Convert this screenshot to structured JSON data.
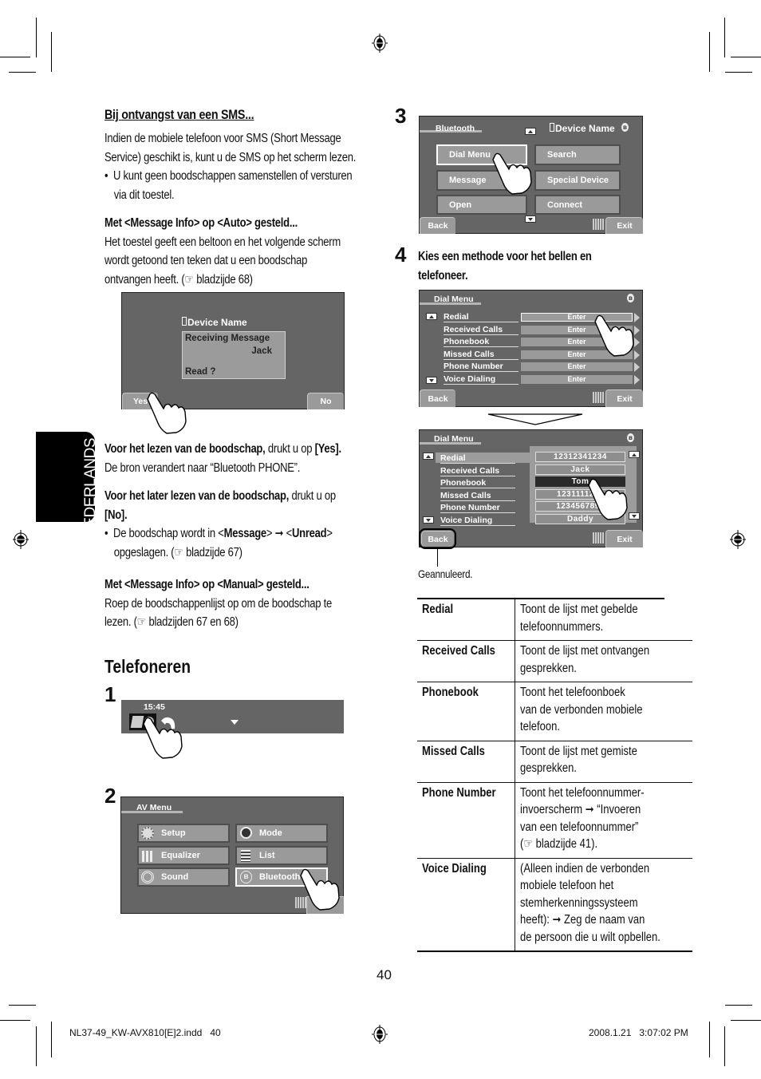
{
  "left": {
    "sms_heading": "Bij ontvangst van een SMS...",
    "sms_intro_1": "Indien de mobiele telefoon voor SMS (Short Message",
    "sms_intro_2": "Service) geschikt is, kunt u de SMS op het scherm lezen.",
    "sms_bullet_1": "U kunt geen boodschappen samenstellen of versturen",
    "sms_bullet_2": "via dit toestel.",
    "auto_heading": "Met <Message Info> op <Auto> gesteld...",
    "auto_text_1": "Het toestel geeft een beltoon en het volgende scherm",
    "auto_text_2": "wordt getoond ten teken dat u een boodschap",
    "auto_text_3": "ontvangen heeft. (☞ bladzijde 68)",
    "sms_screen": {
      "device_name": "Device Name",
      "line1": "Receiving Message",
      "line2": "Jack",
      "line3": "Read ?",
      "yes_label": "Yes",
      "no_label": "No"
    },
    "read_now_bold": "Voor het lezen van de boodschap,",
    "read_now_rest": " drukt u op ",
    "read_now_key": "[Yes].",
    "read_now_text": "De bron verandert naar “Bluetooth PHONE”.",
    "read_later_bold": "Voor het later lezen van de boodschap,",
    "read_later_rest": " drukt u op",
    "read_later_key": "[No].",
    "read_later_bullet_a": "De boodschap wordt in <",
    "read_later_bullet_b": "Message",
    "read_later_bullet_c": "> ➞ <",
    "read_later_bullet_d": "Unread",
    "read_later_bullet_e": ">",
    "read_later_bullet_2": "opgeslagen. (☞ bladzijde 67)",
    "manual_heading": "Met <Message Info> op <Manual> gesteld...",
    "manual_text_1": "Roep de boodschappenlijst op om de boodschap te",
    "manual_text_2": "lezen. (☞ bladzijden 67 en 68)",
    "section_title": "Telefoneren",
    "step1": "1",
    "step1_screen": {
      "time": "15:45"
    },
    "step2": "2",
    "av_menu": {
      "title": "AV Menu",
      "items": [
        {
          "label": "Setup",
          "icon": "gear-icon"
        },
        {
          "label": "Mode",
          "icon": "mode-icon"
        },
        {
          "label": "Equalizer",
          "icon": "equalizer-icon"
        },
        {
          "label": "List",
          "icon": "list-icon"
        },
        {
          "label": "Sound",
          "icon": "sound-icon"
        },
        {
          "label": "Bluetooth",
          "icon": "bluetooth-icon"
        }
      ]
    }
  },
  "side_tab": "NEDERLANDS",
  "right": {
    "step3": "3",
    "bt_screen": {
      "title": "Bluetooth",
      "device_name": "Device Name",
      "buttons": [
        "Dial Menu",
        "Search",
        "Message",
        "Special Device",
        "Open",
        "Connect"
      ],
      "back_label": "Back",
      "exit_label": "Exit"
    },
    "step4": "4",
    "step4_text_1": "Kies een methode voor het bellen en",
    "step4_text_2": "telefoneer.",
    "dial_screen": {
      "title": "Dial Menu",
      "items": [
        "Redial",
        "Received Calls",
        "Phonebook",
        "Missed Calls",
        "Phone Number",
        "Voice Dialing"
      ],
      "enter_label": "Enter",
      "back_label": "Back",
      "exit_label": "Exit"
    },
    "dial_screen_2": {
      "title": "Dial Menu",
      "items": [
        "Redial",
        "Received Calls",
        "Phonebook",
        "Missed Calls",
        "Phone Number",
        "Voice Dialing"
      ],
      "numbers": [
        "12312341234",
        "Jack",
        "Tom",
        "1231111222",
        "1234567890",
        "Daddy"
      ],
      "selected_number": "Tom",
      "back_label": "Back",
      "exit_label": "Exit"
    },
    "cancel_caption": "Geannuleerd.",
    "table": [
      {
        "term": "Redial",
        "desc": [
          "Toont de lijst met gebelde",
          "telefoonnummers."
        ]
      },
      {
        "term": "Received Calls",
        "desc": [
          "Toont de lijst met ontvangen",
          "gesprekken."
        ]
      },
      {
        "term": "Phonebook",
        "desc": [
          "Toont het telefoonboek",
          "van de verbonden mobiele",
          "telefoon."
        ]
      },
      {
        "term": "Missed Calls",
        "desc": [
          "Toont de lijst met gemiste",
          "gesprekken."
        ]
      },
      {
        "term": "Phone Number",
        "desc": [
          "Toont het telefoonnummer-",
          "invoerscherm ➞ “Invoeren",
          "van een telefoonnummer”",
          "(☞ bladzijde 41)."
        ]
      },
      {
        "term": "Voice Dialing",
        "desc": [
          "(Alleen indien de verbonden",
          "mobiele telefoon het",
          "stemherkenningssysteem",
          "heeft): ➞ Zeg de naam van",
          "de persoon die u wilt opbellen."
        ]
      }
    ]
  },
  "page_number": "40",
  "footer": {
    "file": "NL37-49_KW-AVX810[E]2.indd   40",
    "timestamp": "2008.1.21   3:07:02 PM"
  }
}
